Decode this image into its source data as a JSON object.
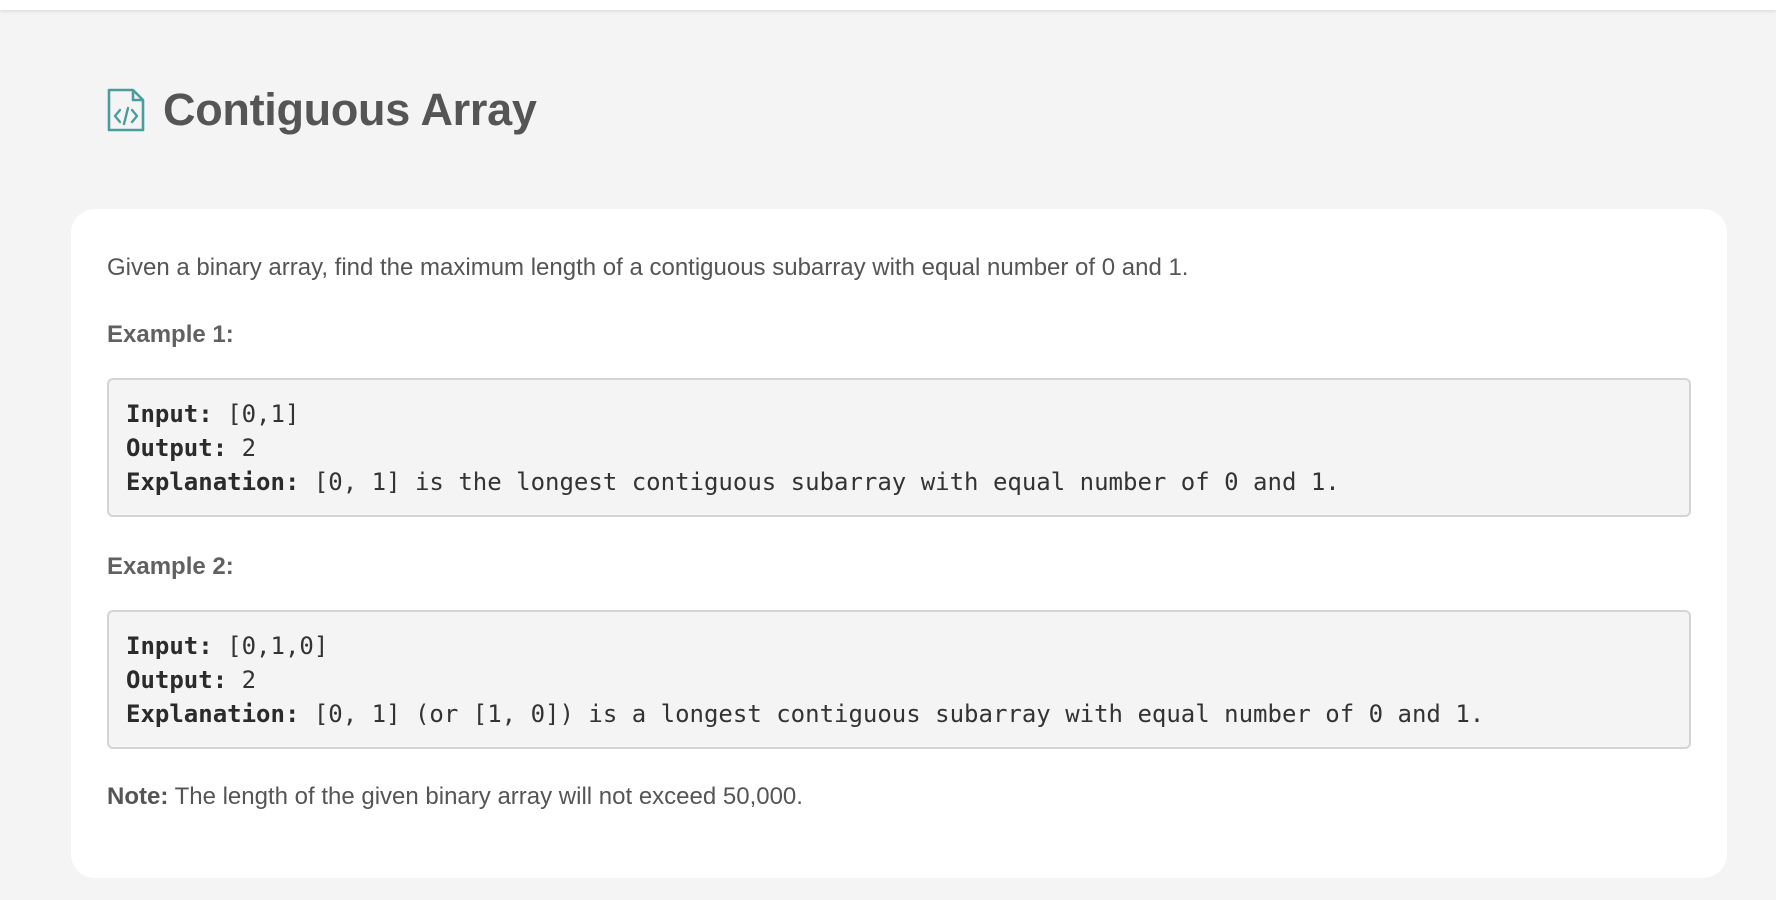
{
  "page": {
    "title": "Contiguous Array",
    "icon": "code-file-icon",
    "accent_color": "#4a9d9c"
  },
  "problem": {
    "description": "Given a binary array, find the maximum length of a contiguous subarray with equal number of 0 and 1.",
    "examples": [
      {
        "heading": "Example 1:",
        "input_label": "Input:",
        "input_value": " [0,1]",
        "output_label": "Output:",
        "output_value": " 2",
        "explanation_label": "Explanation:",
        "explanation_value": " [0, 1] is the longest contiguous subarray with equal number of 0 and 1."
      },
      {
        "heading": "Example 2:",
        "input_label": "Input:",
        "input_value": " [0,1,0]",
        "output_label": "Output:",
        "output_value": " 2",
        "explanation_label": "Explanation:",
        "explanation_value": " [0, 1] (or [1, 0]) is a longest contiguous subarray with equal number of 0 and 1."
      }
    ],
    "note_label": "Note:",
    "note_text": " The length of the given binary array will not exceed 50,000."
  }
}
